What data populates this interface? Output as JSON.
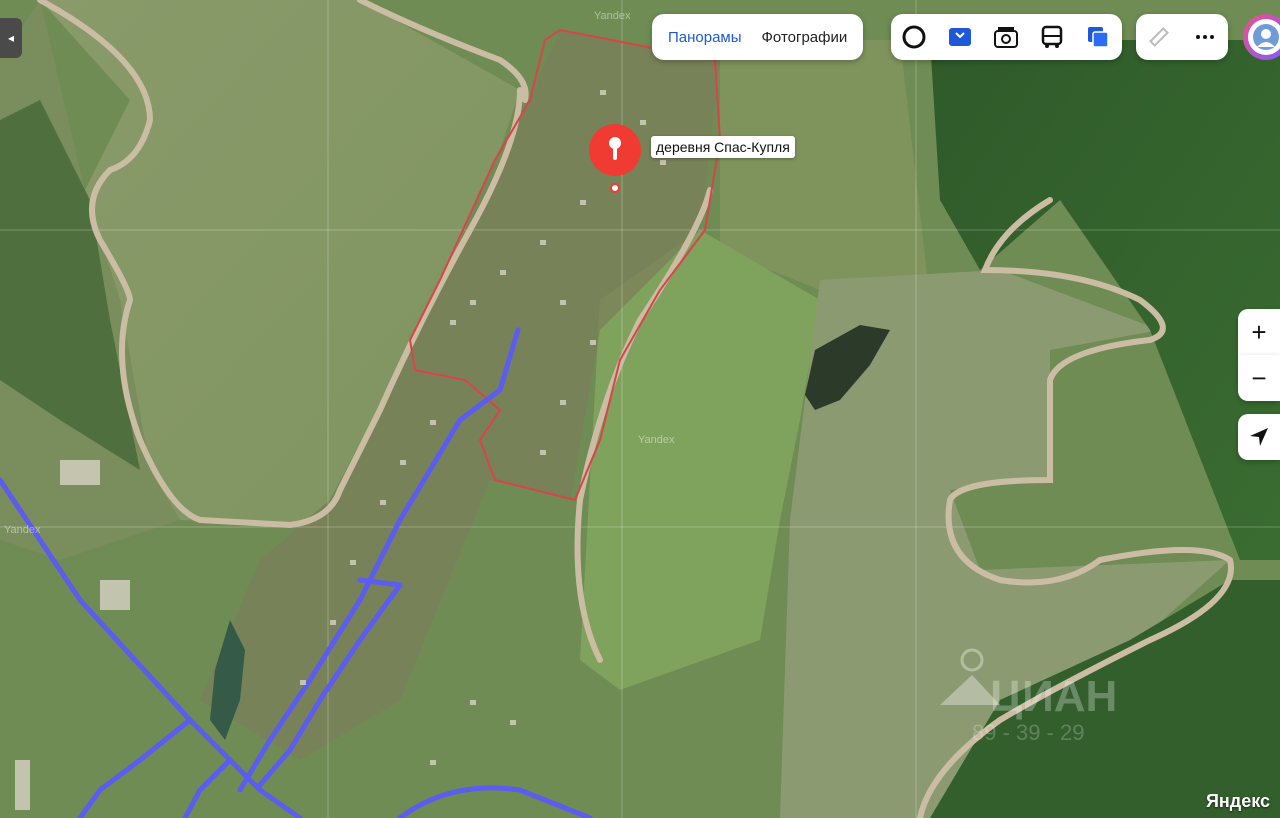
{
  "map": {
    "attribution_top": "Yandex",
    "attribution_mid": "Yandex",
    "attribution_left": "Yandex",
    "brand": "Яндекс",
    "watermark": "ЦИАН",
    "watermark_id": "89 - 39 - 29"
  },
  "place": {
    "label": "деревня Спас-Купля"
  },
  "layers": {
    "tabs": [
      {
        "label": "Панорамы",
        "active": true
      },
      {
        "label": "Фотографии",
        "active": false
      }
    ]
  },
  "tools": {
    "icons": [
      "circle-icon",
      "map-book-icon",
      "camera-icon",
      "bus-icon",
      "layers-icon"
    ],
    "more": [
      "ruler-icon",
      "more-icon"
    ]
  },
  "side": {
    "zoom_in": "+",
    "zoom_out": "−"
  },
  "colors": {
    "accent": "#1f58d8",
    "marker": "#f03b32",
    "route": "#5b5cf0",
    "boundary": "#d9434a",
    "road": "#c6b9a1"
  }
}
